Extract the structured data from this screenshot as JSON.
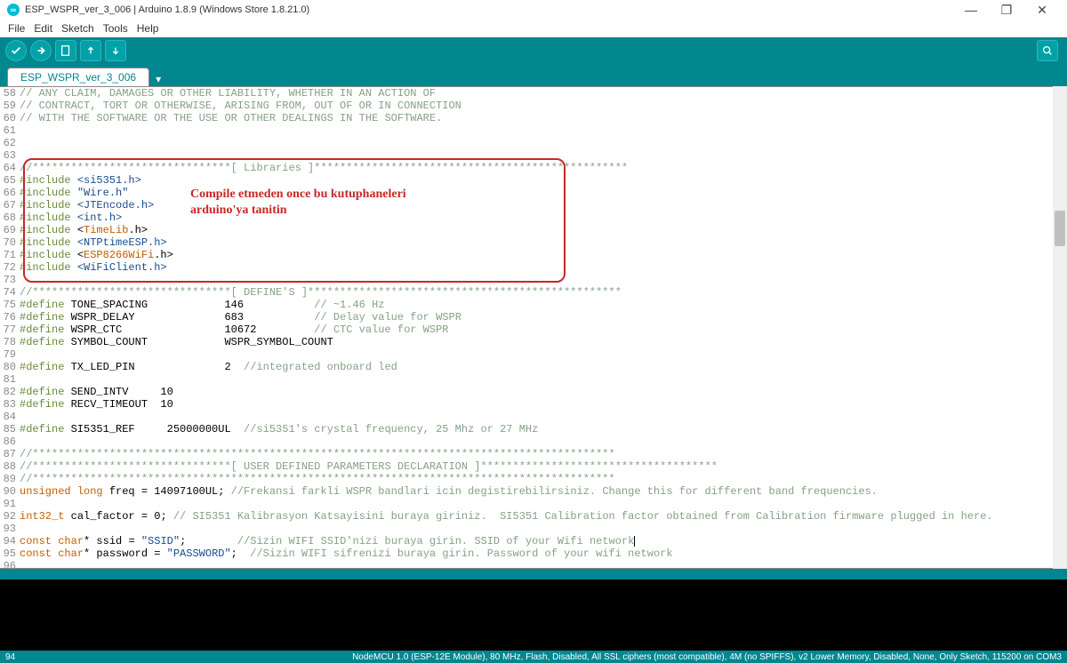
{
  "window": {
    "title": "ESP_WSPR_ver_3_006 | Arduino 1.8.9 (Windows Store 1.8.21.0)"
  },
  "menu": {
    "file": "File",
    "edit": "Edit",
    "sketch": "Sketch",
    "tools": "Tools",
    "help": "Help"
  },
  "tab": {
    "name": "ESP_WSPR_ver_3_006"
  },
  "overlay": {
    "line1": "Compile etmeden once bu kutuphaneleri",
    "line2": "arduino'ya tanitin"
  },
  "code": {
    "lines": [
      {
        "n": 58,
        "segs": [
          {
            "c": "comment",
            "t": "// ANY CLAIM, DAMAGES OR OTHER LIABILITY, WHETHER IN AN ACTION OF"
          }
        ]
      },
      {
        "n": 59,
        "segs": [
          {
            "c": "comment",
            "t": "// CONTRACT, TORT OR OTHERWISE, ARISING FROM, OUT OF OR IN CONNECTION"
          }
        ]
      },
      {
        "n": 60,
        "segs": [
          {
            "c": "comment",
            "t": "// WITH THE SOFTWARE OR THE USE OR OTHER DEALINGS IN THE SOFTWARE."
          }
        ]
      },
      {
        "n": 61,
        "segs": []
      },
      {
        "n": 62,
        "segs": []
      },
      {
        "n": 63,
        "segs": []
      },
      {
        "n": 64,
        "segs": [
          {
            "c": "comment",
            "t": "//*******************************[ Libraries ]*************************************************"
          }
        ]
      },
      {
        "n": 65,
        "segs": [
          {
            "c": "preproc",
            "t": "#include "
          },
          {
            "c": "string",
            "t": "<si5351.h>"
          }
        ]
      },
      {
        "n": 66,
        "segs": [
          {
            "c": "preproc",
            "t": "#include "
          },
          {
            "c": "string",
            "t": "\"Wire.h\""
          }
        ]
      },
      {
        "n": 67,
        "segs": [
          {
            "c": "preproc",
            "t": "#include "
          },
          {
            "c": "string",
            "t": "<JTEncode.h>"
          }
        ]
      },
      {
        "n": 68,
        "segs": [
          {
            "c": "preproc",
            "t": "#include "
          },
          {
            "c": "string",
            "t": "<int.h>"
          }
        ]
      },
      {
        "n": 69,
        "segs": [
          {
            "c": "preproc",
            "t": "#include "
          },
          {
            "c": "ident",
            "t": "<"
          },
          {
            "c": "type",
            "t": "TimeLib"
          },
          {
            "c": "ident",
            "t": ".h>"
          }
        ]
      },
      {
        "n": 70,
        "segs": [
          {
            "c": "preproc",
            "t": "#include "
          },
          {
            "c": "string",
            "t": "<NTPtimeESP.h>"
          }
        ]
      },
      {
        "n": 71,
        "segs": [
          {
            "c": "preproc",
            "t": "#include "
          },
          {
            "c": "ident",
            "t": "<"
          },
          {
            "c": "type",
            "t": "ESP8266WiFi"
          },
          {
            "c": "ident",
            "t": ".h>"
          }
        ]
      },
      {
        "n": 72,
        "segs": [
          {
            "c": "preproc",
            "t": "#include "
          },
          {
            "c": "string",
            "t": "<WiFiClient.h>"
          }
        ]
      },
      {
        "n": 73,
        "segs": []
      },
      {
        "n": 74,
        "segs": [
          {
            "c": "comment",
            "t": "//*******************************[ DEFINE'S ]*************************************************"
          }
        ]
      },
      {
        "n": 75,
        "segs": [
          {
            "c": "preproc",
            "t": "#define "
          },
          {
            "c": "ident",
            "t": "TONE_SPACING            146           "
          },
          {
            "c": "comment",
            "t": "// ~1.46 Hz"
          }
        ]
      },
      {
        "n": 76,
        "segs": [
          {
            "c": "preproc",
            "t": "#define "
          },
          {
            "c": "ident",
            "t": "WSPR_DELAY              683           "
          },
          {
            "c": "comment",
            "t": "// Delay value for WSPR"
          }
        ]
      },
      {
        "n": 77,
        "segs": [
          {
            "c": "preproc",
            "t": "#define "
          },
          {
            "c": "ident",
            "t": "WSPR_CTC                10672         "
          },
          {
            "c": "comment",
            "t": "// CTC value for WSPR"
          }
        ]
      },
      {
        "n": 78,
        "segs": [
          {
            "c": "preproc",
            "t": "#define "
          },
          {
            "c": "ident",
            "t": "SYMBOL_COUNT            WSPR_SYMBOL_COUNT"
          }
        ]
      },
      {
        "n": 79,
        "segs": []
      },
      {
        "n": 80,
        "segs": [
          {
            "c": "preproc",
            "t": "#define "
          },
          {
            "c": "ident",
            "t": "TX_LED_PIN              2  "
          },
          {
            "c": "comment",
            "t": "//integrated onboard led"
          }
        ]
      },
      {
        "n": 81,
        "segs": []
      },
      {
        "n": 82,
        "segs": [
          {
            "c": "preproc",
            "t": "#define "
          },
          {
            "c": "ident",
            "t": "SEND_INTV     10"
          }
        ]
      },
      {
        "n": 83,
        "segs": [
          {
            "c": "preproc",
            "t": "#define "
          },
          {
            "c": "ident",
            "t": "RECV_TIMEOUT  10"
          }
        ]
      },
      {
        "n": 84,
        "segs": []
      },
      {
        "n": 85,
        "segs": [
          {
            "c": "preproc",
            "t": "#define "
          },
          {
            "c": "ident",
            "t": "SI5351_REF     25000000UL  "
          },
          {
            "c": "comment",
            "t": "//si5351's crystal frequency, 25 Mhz or 27 MHz"
          }
        ]
      },
      {
        "n": 86,
        "segs": []
      },
      {
        "n": 87,
        "segs": [
          {
            "c": "comment",
            "t": "//*******************************************************************************************"
          }
        ]
      },
      {
        "n": 88,
        "segs": [
          {
            "c": "comment",
            "t": "//*******************************[ USER DEFINED PARAMETERS DECLARATION ]*************************************"
          }
        ]
      },
      {
        "n": 89,
        "segs": [
          {
            "c": "comment",
            "t": "//*******************************************************************************************"
          }
        ]
      },
      {
        "n": 90,
        "segs": [
          {
            "c": "keyword",
            "t": "unsigned"
          },
          {
            "c": "ident",
            "t": " "
          },
          {
            "c": "keyword",
            "t": "long"
          },
          {
            "c": "ident",
            "t": " freq = 14097100UL; "
          },
          {
            "c": "comment",
            "t": "//Frekansi farkli WSPR bandlari icin degistirebilirsiniz. Change this for different band frequencies."
          }
        ]
      },
      {
        "n": 91,
        "segs": []
      },
      {
        "n": 92,
        "segs": [
          {
            "c": "keyword",
            "t": "int32_t"
          },
          {
            "c": "ident",
            "t": " cal_factor = 0; "
          },
          {
            "c": "comment",
            "t": "// SI5351 Kalibrasyon Katsayisini buraya giriniz.  SI5351 Calibration factor obtained from Calibration firmware plugged in here."
          }
        ]
      },
      {
        "n": 93,
        "segs": []
      },
      {
        "n": 94,
        "segs": [
          {
            "c": "keyword",
            "t": "const"
          },
          {
            "c": "ident",
            "t": " "
          },
          {
            "c": "keyword",
            "t": "char"
          },
          {
            "c": "ident",
            "t": "* ssid = "
          },
          {
            "c": "string",
            "t": "\"SSID\""
          },
          {
            "c": "ident",
            "t": ";        "
          },
          {
            "c": "comment",
            "t": "//Sizin WIFI SSID'nizi buraya girin. SSID of your Wifi network"
          }
        ],
        "cursor": true
      },
      {
        "n": 95,
        "segs": [
          {
            "c": "keyword",
            "t": "const"
          },
          {
            "c": "ident",
            "t": " "
          },
          {
            "c": "keyword",
            "t": "char"
          },
          {
            "c": "ident",
            "t": "* password = "
          },
          {
            "c": "string",
            "t": "\"PASSWORD\""
          },
          {
            "c": "ident",
            "t": ";  "
          },
          {
            "c": "comment",
            "t": "//Sizin WIFI sifrenizi buraya girin. Password of your wifi network"
          }
        ]
      },
      {
        "n": 96,
        "segs": []
      }
    ]
  },
  "status": {
    "line": "94",
    "board": "NodeMCU 1.0 (ESP-12E Module), 80 MHz, Flash, Disabled, All SSL ciphers (most compatible), 4M (no SPIFFS), v2 Lower Memory, Disabled, None, Only Sketch, 115200 on COM3"
  }
}
